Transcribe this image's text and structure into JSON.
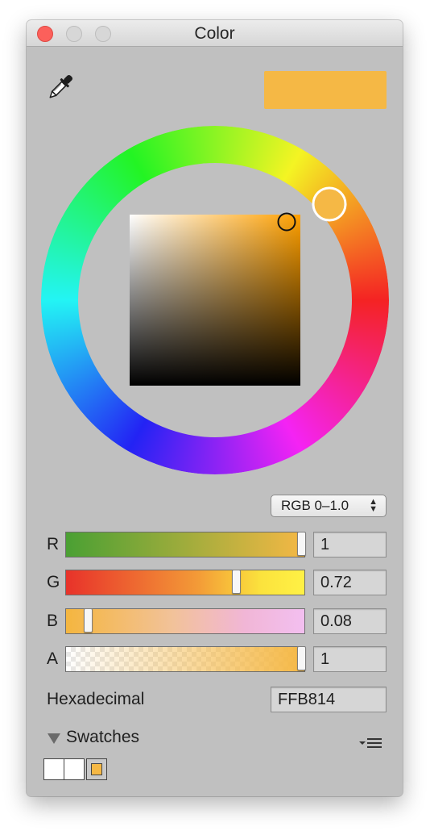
{
  "window": {
    "title": "Color"
  },
  "color": {
    "hex_color": "#F5B845",
    "alpha": 1
  },
  "picker": {
    "hue_degrees": 38,
    "saturation": 0.92,
    "brightness": 0.96
  },
  "mode_select": {
    "value": "RGB 0–1.0"
  },
  "sliders": [
    {
      "label": "R",
      "value": "1",
      "fraction": 1.0
    },
    {
      "label": "G",
      "value": "0.72",
      "fraction": 0.72
    },
    {
      "label": "B",
      "value": "0.08",
      "fraction": 0.08
    },
    {
      "label": "A",
      "value": "1",
      "fraction": 1.0
    }
  ],
  "hex_row": {
    "label": "Hexadecimal",
    "value": "FFB814"
  },
  "swatches": {
    "label": "Swatches",
    "items": [
      {
        "color": "#FFFFFF",
        "selected": false
      },
      {
        "color": "#FFFFFF",
        "selected": false
      },
      {
        "color": "#F5B845",
        "selected": true
      }
    ]
  },
  "icons": {
    "eyedropper": "eyedropper-icon",
    "disclosure": "triangle-down-icon",
    "swatch_menu": "list-menu-icon",
    "select_arrows": "updown-arrows-icon"
  }
}
